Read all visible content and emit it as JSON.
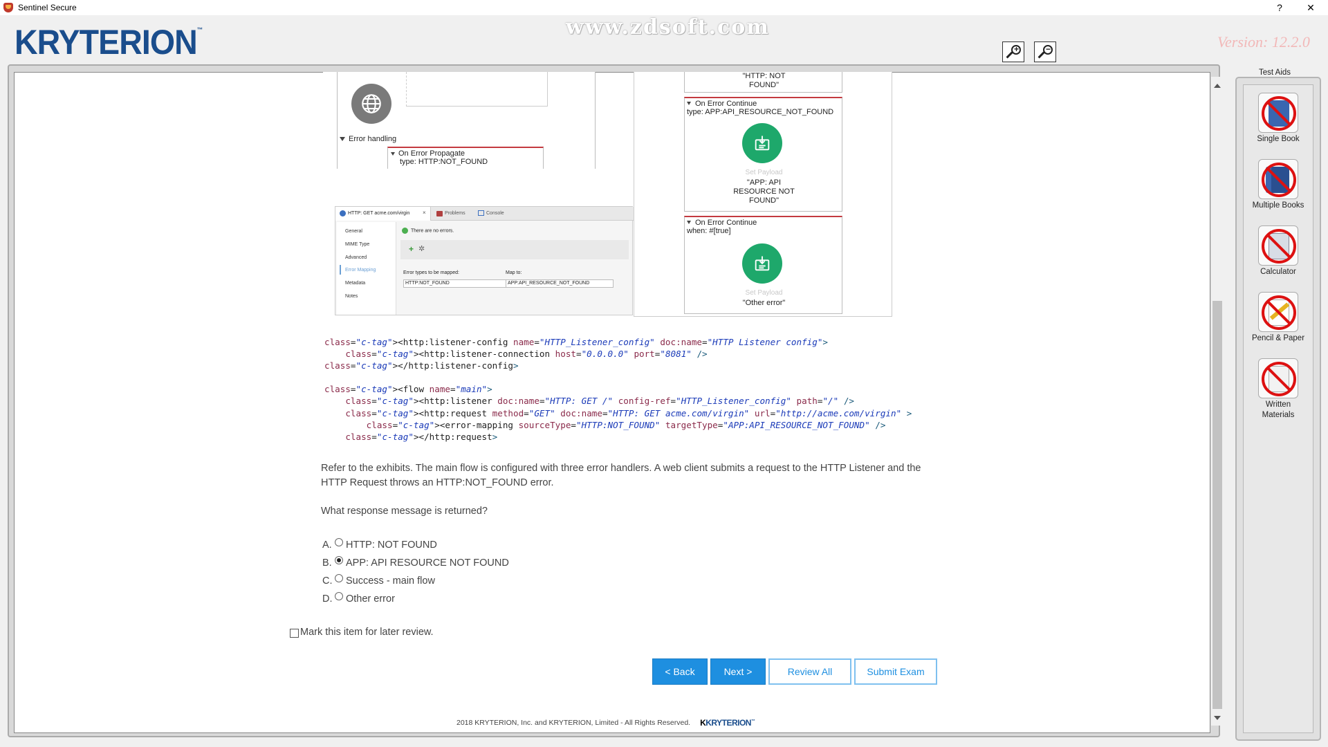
{
  "window": {
    "title": "Sentinel Secure",
    "help_label": "?",
    "close_label": "✕"
  },
  "header": {
    "logo": "KRYTERION",
    "logo_tm": "™",
    "watermark": "www.zdsoft.com",
    "version": "Version:  12.2.0",
    "zoom_in_icon": "zoom-in-icon",
    "zoom_out_icon": "zoom-out-icon"
  },
  "exhibit_flow": {
    "error_handling_label": "Error handling",
    "propagate_title": "On Error Propagate",
    "propagate_type": "type: HTTP:NOT_FOUND"
  },
  "exhibit_config": {
    "tab_label": "HTTP: GET acme.com/virgin",
    "tab_problems": "Problems",
    "tab_console": "Console",
    "status": "There are no errors.",
    "nav_items": [
      "General",
      "MIME Type",
      "Advanced",
      "Error Mapping",
      "Metadata",
      "Notes"
    ],
    "selected_nav": "Error Mapping",
    "error_types_label": "Error types to be mapped:",
    "map_to_label": "Map to:",
    "error_type_value": "HTTP:NOT_FOUND",
    "map_to_value": "APP:API_RESOURCE_NOT_FOUND"
  },
  "exhibit_handlers": {
    "top_value_line1": "\"HTTP: NOT",
    "top_value_line2": "FOUND\"",
    "handler2_title": "On Error Continue",
    "handler2_type": "type: APP:API_RESOURCE_NOT_FOUND",
    "handler2_component": "Set Payload",
    "handler2_value_line1": "\"APP: API",
    "handler2_value_line2": "RESOURCE NOT",
    "handler2_value_line3": "FOUND\"",
    "handler3_title": "On Error Continue",
    "handler3_when": "when: #[true]",
    "handler3_component": "Set Payload",
    "handler3_value": "\"Other error\""
  },
  "code_lines": [
    "<http:listener-config name=\"HTTP_Listener_config\" doc:name=\"HTTP Listener config\">",
    "    <http:listener-connection host=\"0.0.0.0\" port=\"8081\" />",
    "</http:listener-config>",
    "",
    "<flow name=\"main\">",
    "    <http:listener doc:name=\"HTTP: GET /\" config-ref=\"HTTP_Listener_config\" path=\"/\" />",
    "    <http:request method=\"GET\" doc:name=\"HTTP: GET acme.com/virgin\" url=\"http://acme.com/virgin\" >",
    "        <error-mapping sourceType=\"HTTP:NOT_FOUND\" targetType=\"APP:API_RESOURCE_NOT_FOUND\" />",
    "    </http:request>"
  ],
  "question": {
    "text": "Refer to the exhibits. The main flow is configured with three error handlers. A web client submits a request to the HTTP Listener and the HTTP Request throws an HTTP:NOT_FOUND error.",
    "prompt": "What response message is returned?",
    "options": [
      {
        "letter": "A.",
        "text": "HTTP: NOT FOUND",
        "selected": false
      },
      {
        "letter": "B.",
        "text": "APP: API RESOURCE NOT FOUND",
        "selected": true
      },
      {
        "letter": "C.",
        "text": "Success - main flow",
        "selected": false
      },
      {
        "letter": "D.",
        "text": "Other error",
        "selected": false
      }
    ],
    "review_label": "Mark this item for later review."
  },
  "nav": {
    "back": "< Back",
    "next": "Next >",
    "review_all": "Review All",
    "submit": "Submit Exam"
  },
  "footer": {
    "copyright": "2018    KRYTERION, Inc. and KRYTERION, Limited - All Rights Reserved.",
    "logo_k": "K",
    "logo_rest": "KRYTERION",
    "logo_tm": "™"
  },
  "test_aids": {
    "title": "Test Aids",
    "items": [
      {
        "label": "Single Book",
        "icon": "book-icon"
      },
      {
        "label": "Multiple Books",
        "icon": "books-icon"
      },
      {
        "label": "Calculator",
        "icon": "calculator-icon"
      },
      {
        "label": "Pencil & Paper",
        "icon": "pencil-paper-icon"
      },
      {
        "label": "Written Materials",
        "icon": "written-materials-icon"
      }
    ]
  },
  "colors": {
    "brand_blue": "#1a4d8c",
    "button_blue": "#1e8fe0",
    "error_red": "#c4393f",
    "payload_green": "#1ea86b"
  }
}
